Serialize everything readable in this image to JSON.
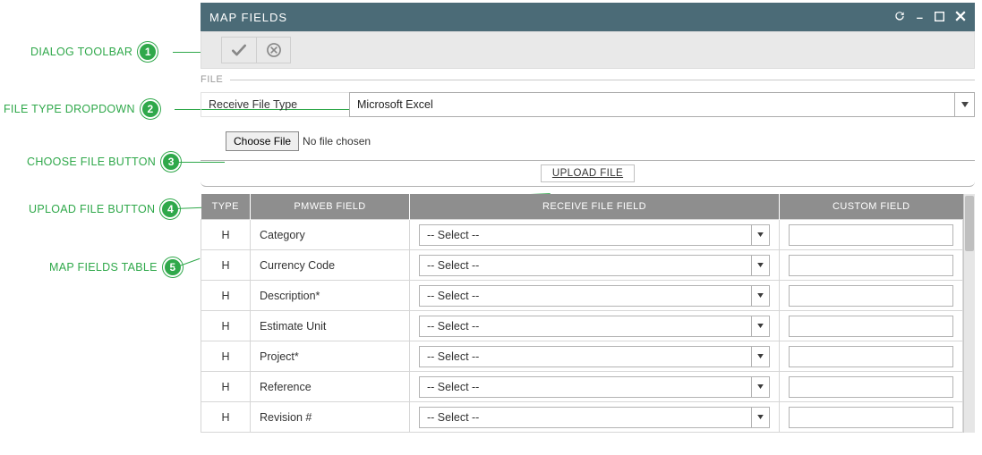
{
  "callouts": {
    "c1": "DIALOG TOOLBAR",
    "c2": "FILE TYPE DROPDOWN",
    "c3": "CHOOSE FILE BUTTON",
    "c4": "UPLOAD FILE BUTTON",
    "c5": "MAP FIELDS TABLE",
    "n1": "1",
    "n2": "2",
    "n3": "3",
    "n4": "4",
    "n5": "5"
  },
  "titlebar": {
    "title": "MAP FIELDS"
  },
  "section": {
    "file_label": "FILE"
  },
  "filetype": {
    "label": "Receive File Type",
    "value": "Microsoft Excel"
  },
  "choose": {
    "button": "Choose File",
    "status": "No file chosen"
  },
  "upload": {
    "label": "UPLOAD FILE"
  },
  "grid": {
    "headers": {
      "type": "TYPE",
      "pmweb": "PMWEB FIELD",
      "recv": "RECEIVE FILE FIELD",
      "custom": "CUSTOM FIELD"
    },
    "select_placeholder": "-- Select --",
    "rows": [
      {
        "type": "H",
        "field": "Category"
      },
      {
        "type": "H",
        "field": "Currency Code"
      },
      {
        "type": "H",
        "field": "Description*"
      },
      {
        "type": "H",
        "field": "Estimate Unit"
      },
      {
        "type": "H",
        "field": "Project*"
      },
      {
        "type": "H",
        "field": "Reference"
      },
      {
        "type": "H",
        "field": "Revision #"
      }
    ]
  }
}
